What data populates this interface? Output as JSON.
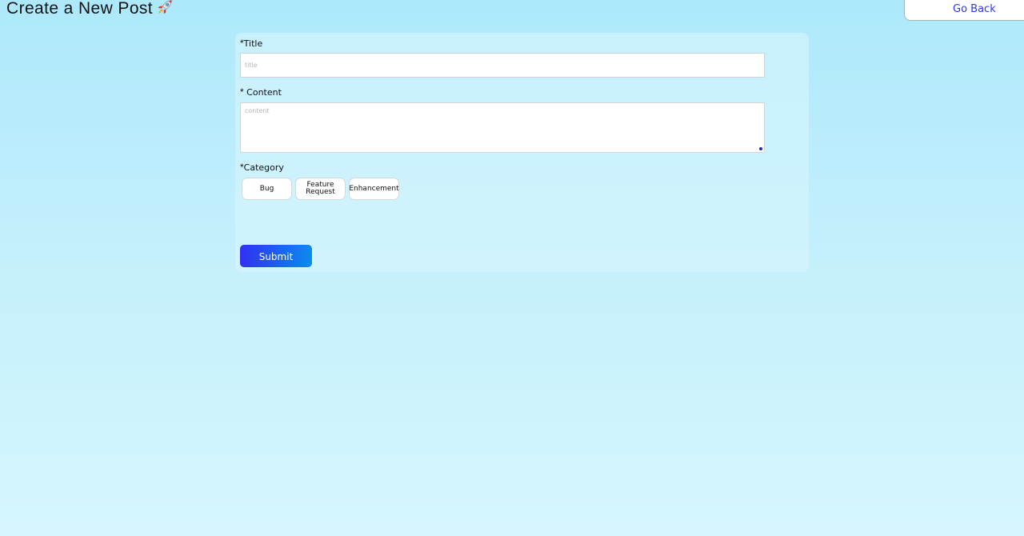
{
  "header": {
    "title": "Create a New Post",
    "go_back_label": "Go Back"
  },
  "form": {
    "title_field": {
      "required_mark": "*",
      "label": "Title",
      "placeholder": "title",
      "value": ""
    },
    "content_field": {
      "required_mark": "*",
      "label": " Content",
      "placeholder": "content",
      "value": ""
    },
    "category_field": {
      "required_mark": "*",
      "label": "Category",
      "options": [
        "Bug",
        "Feature Request",
        "Enhancement"
      ]
    },
    "submit_label": "Submit"
  },
  "icons": {
    "title_icon": "rocket-icon",
    "resize_handle": "resize-handle-icon"
  },
  "colors": {
    "background_top": "#ade9fb",
    "background_bottom": "#d6f6fd",
    "link": "#2b3bd6",
    "submit_gradient_start": "#3030f0",
    "submit_gradient_end": "#0a8cf0"
  }
}
